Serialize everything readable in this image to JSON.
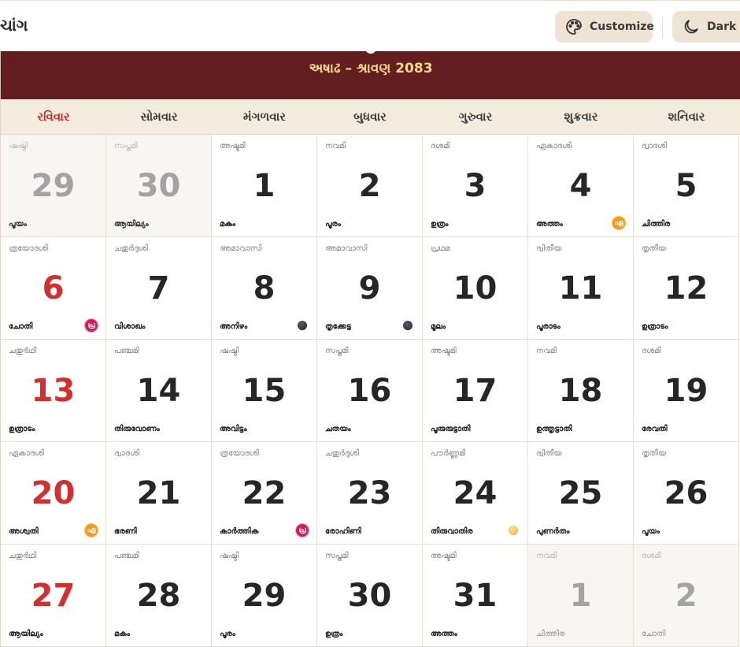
{
  "header": {
    "title": "ચાંગ",
    "customize_label": "Customize",
    "dark_label": "Dark"
  },
  "banner": {
    "title": "અષાઢ – શ્રાવણ 2083"
  },
  "weekdays": [
    "રવિવાર",
    "સોમવાર",
    "મંગળવાર",
    "બુધવાર",
    "ગુરુવાર",
    "શુક્રવાર",
    "શનિવાર"
  ],
  "weeks": [
    [
      {
        "day": "29",
        "tithi": "ഷഷ്ഠി",
        "naks": "പൂയം",
        "out": true
      },
      {
        "day": "30",
        "tithi": "സപ്തമി",
        "naks": "ആയില്യം",
        "out": true
      },
      {
        "day": "1",
        "tithi": "അഷ്ടമി",
        "naks": "മകം"
      },
      {
        "day": "2",
        "tithi": "നവമി",
        "naks": "പൂരം"
      },
      {
        "day": "3",
        "tithi": "ദശമി",
        "naks": "ഉത്രം"
      },
      {
        "day": "4",
        "tithi": "ഏകാദശി",
        "naks": "അത്തം",
        "badge": "ഏ",
        "badge_color": "orange"
      },
      {
        "day": "5",
        "tithi": "ദ്വാദശി",
        "naks": "ചിത്തിര"
      }
    ],
    [
      {
        "day": "6",
        "tithi": "ത്രയോദശി",
        "naks": "ചോതി",
        "badge": "പ്ര",
        "badge_color": "pink"
      },
      {
        "day": "7",
        "tithi": "ചതുർദ്ദശി",
        "naks": "വിശാഖം"
      },
      {
        "day": "8",
        "tithi": "അമാവാസി",
        "naks": "അനിഴം",
        "moon": "new"
      },
      {
        "day": "9",
        "tithi": "അമാവാസി",
        "naks": "തൃക്കേട്ട",
        "moon": "new"
      },
      {
        "day": "10",
        "tithi": "പ്രഥമ",
        "naks": "മൂലം"
      },
      {
        "day": "11",
        "tithi": "ദ്വിതീയ",
        "naks": "പൂരാടം"
      },
      {
        "day": "12",
        "tithi": "തൃതീയ",
        "naks": "ഉത്രാടം"
      }
    ],
    [
      {
        "day": "13",
        "tithi": "ചതുർഥി",
        "naks": "ഉത്രാടം"
      },
      {
        "day": "14",
        "tithi": "പഞ്ചമി",
        "naks": "തിരുവോണം"
      },
      {
        "day": "15",
        "tithi": "ഷഷ്ഠി",
        "naks": "അവിട്ടം"
      },
      {
        "day": "16",
        "tithi": "സപ്തമി",
        "naks": "ചതയം"
      },
      {
        "day": "17",
        "tithi": "അഷ്ടമി",
        "naks": "പൂരുരുട്ടാതി"
      },
      {
        "day": "18",
        "tithi": "നവമി",
        "naks": "ഉത്തൃട്ടാതി"
      },
      {
        "day": "19",
        "tithi": "ദശമി",
        "naks": "രേവതി"
      }
    ],
    [
      {
        "day": "20",
        "tithi": "ഏകാദശി",
        "naks": "അശ്വതി",
        "badge": "ഏ",
        "badge_color": "orange"
      },
      {
        "day": "21",
        "tithi": "ദ്വാദശി",
        "naks": "ഭരണി"
      },
      {
        "day": "22",
        "tithi": "ത്രയോദശി",
        "naks": "കാർത്തിക",
        "badge": "പ്ര",
        "badge_color": "pink"
      },
      {
        "day": "23",
        "tithi": "ചതുർദ്ദശി",
        "naks": "രോഹിണി"
      },
      {
        "day": "24",
        "tithi": "പൗർണ്ണമി",
        "naks": "തിരുവാതിര",
        "moon": "full"
      },
      {
        "day": "25",
        "tithi": "ദ്വിതീയ",
        "naks": "പുണർതം"
      },
      {
        "day": "26",
        "tithi": "തൃതീയ",
        "naks": "പൂയം"
      }
    ],
    [
      {
        "day": "27",
        "tithi": "ചതുർഥി",
        "naks": "ആയില്യം"
      },
      {
        "day": "28",
        "tithi": "പഞ്ചമി",
        "naks": "മകം"
      },
      {
        "day": "29",
        "tithi": "ഷഷ്ഠി",
        "naks": "പൂരം"
      },
      {
        "day": "30",
        "tithi": "സപ്തമി",
        "naks": "ഉത്രം"
      },
      {
        "day": "31",
        "tithi": "അഷ്ടമി",
        "naks": "അത്തം"
      },
      {
        "day": "1",
        "tithi": "നവമി",
        "naks": "ചിത്തിര",
        "out": true,
        "next": true
      },
      {
        "day": "2",
        "tithi": "ദശമി",
        "naks": "ചോതി",
        "out": true,
        "next": true
      }
    ]
  ]
}
